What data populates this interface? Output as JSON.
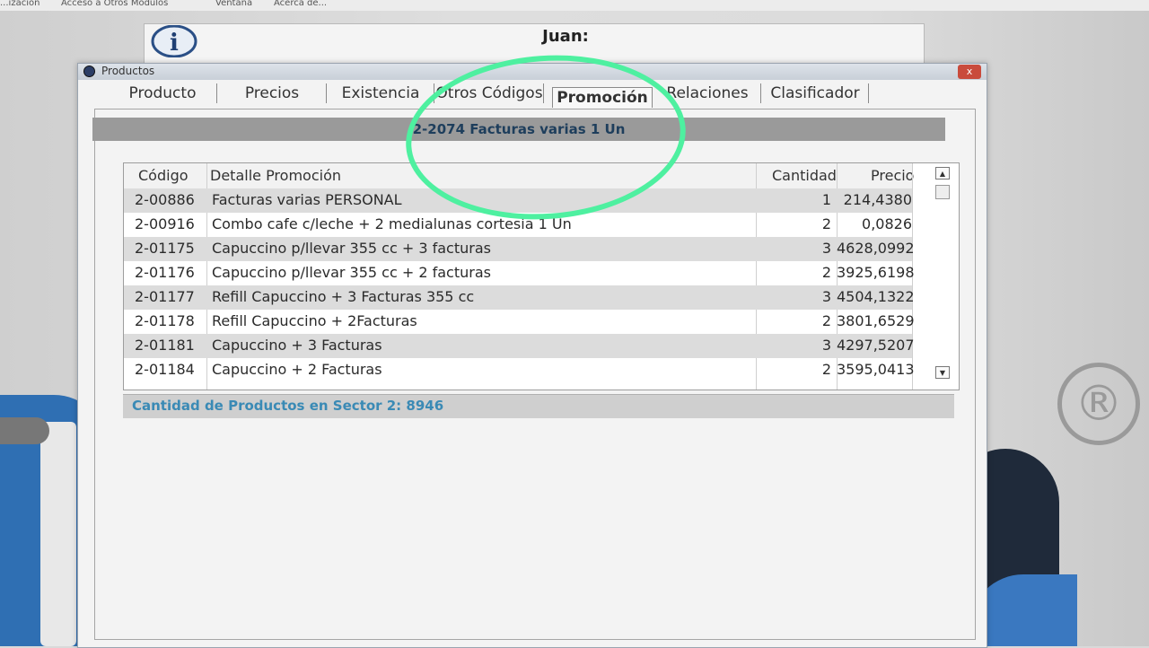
{
  "background": {
    "menu_items": [
      "...ización",
      "Acceso a Otros Módulos",
      "Ventana",
      "Acerca de..."
    ],
    "dialog_title": "Juan:"
  },
  "window": {
    "title": "Productos",
    "close_label": "x"
  },
  "tabs": [
    {
      "label": "Producto"
    },
    {
      "label": "Precios"
    },
    {
      "label": "Existencia"
    },
    {
      "label": "Otros Códigos"
    },
    {
      "label": "Promoción"
    },
    {
      "label": "Relaciones"
    },
    {
      "label": "Clasificador"
    }
  ],
  "active_tab": "Promoción",
  "product_header": "2-2074 Facturas varias 1 Un",
  "table": {
    "columns": [
      "Código",
      "Detalle Promoción",
      "Cantidad",
      "Precio"
    ],
    "rows": [
      {
        "codigo": "2-00886",
        "detalle": "Facturas varias PERSONAL",
        "cantidad": "1",
        "precio": "214,4380"
      },
      {
        "codigo": "2-00916",
        "detalle": "Combo cafe c/leche + 2 medialunas cortesia 1 Un",
        "cantidad": "2",
        "precio": "0,0826"
      },
      {
        "codigo": "2-01175",
        "detalle": "Capuccino p/llevar 355 cc + 3 facturas",
        "cantidad": "3",
        "precio": "4628,0992"
      },
      {
        "codigo": "2-01176",
        "detalle": "Capuccino p/llevar 355 cc + 2 facturas",
        "cantidad": "2",
        "precio": "3925,6198"
      },
      {
        "codigo": "2-01177",
        "detalle": "Refill Capuccino + 3 Facturas 355 cc",
        "cantidad": "3",
        "precio": "4504,1322"
      },
      {
        "codigo": "2-01178",
        "detalle": "Refill Capuccino + 2Facturas",
        "cantidad": "2",
        "precio": "3801,6529"
      },
      {
        "codigo": "2-01181",
        "detalle": "Capuccino + 3 Facturas",
        "cantidad": "3",
        "precio": "4297,5207"
      },
      {
        "codigo": "2-01184",
        "detalle": "Capuccino + 2 Facturas",
        "cantidad": "2",
        "precio": "3595,0413"
      }
    ]
  },
  "status": "Cantidad de Productos en Sector 2: 8946",
  "colors": {
    "annotation": "#4ef0a0",
    "status_text": "#3a8ab5",
    "header_bar": "#9a9a9a"
  }
}
